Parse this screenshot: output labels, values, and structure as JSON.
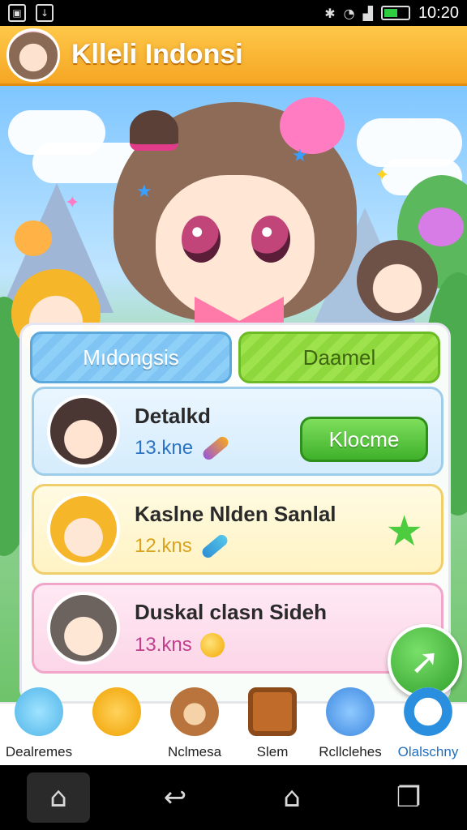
{
  "status_bar": {
    "time": "10:20",
    "icons": [
      "image-icon",
      "download-icon",
      "bluetooth-icon",
      "wifi-icon",
      "signal-icon",
      "battery-icon"
    ]
  },
  "header": {
    "title": "Klleli Indonsi"
  },
  "tabs": [
    {
      "label": "Mıdongsis",
      "color": "#7fc4f2"
    },
    {
      "label": "Daamel",
      "color": "#8ed83e"
    }
  ],
  "cards": [
    {
      "title": "Detalkd",
      "subtitle": "13.kne",
      "action_label": "Klocme",
      "accent": "#2d74c4"
    },
    {
      "title": "Kaslne Nlden Sanlal",
      "subtitle": "12.kns",
      "action": "star-icon",
      "accent": "#d9a320"
    },
    {
      "title": "Duskal clasn Sideh",
      "subtitle": "13.kns",
      "accent": "#c23f8e"
    }
  ],
  "bottom_nav": [
    {
      "label": "Dealremes",
      "icon": "cat-icon"
    },
    {
      "label": "",
      "icon": "pineapple-icon"
    },
    {
      "label": "Nclmesa",
      "icon": "bear-icon"
    },
    {
      "label": "Slem",
      "icon": "tv-icon"
    },
    {
      "label": "Rcllclehes",
      "icon": "blue-cat-icon"
    },
    {
      "label": "Olalschny",
      "icon": "ring-icon",
      "active": true
    }
  ],
  "colors": {
    "header": "#f5a623",
    "primary_green": "#3fb12b",
    "active_nav": "#1f6fbf"
  }
}
